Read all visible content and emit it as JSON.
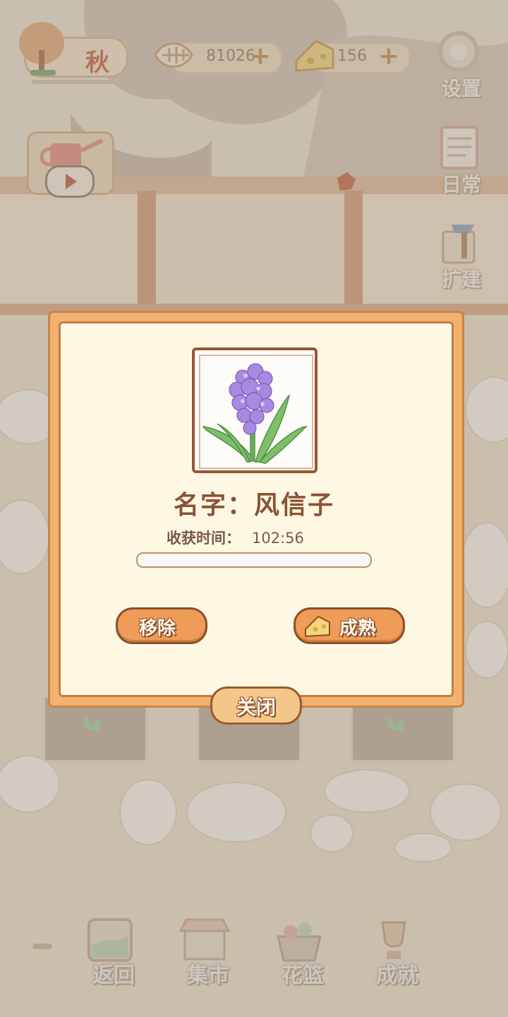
{
  "top": {
    "season": "秋",
    "fish_count": "81026",
    "cheese_count": "156",
    "plus": "+"
  },
  "side": {
    "settings": "设置",
    "daily": "日常",
    "expand": "扩建"
  },
  "nav": {
    "back": "返回",
    "market": "集市",
    "basket": "花篮",
    "achievement": "成就"
  },
  "dialog": {
    "name_line": "名字：风信子",
    "harvest_label": "收获时间：",
    "harvest_time": "102:56",
    "progress": 0,
    "remove_label": "移除",
    "mature_label": "成熟",
    "close_label": "关闭"
  },
  "colors": {
    "dialog_border": "#f2b26e",
    "button": "#ee9c57",
    "flower": "#a78ae0"
  }
}
